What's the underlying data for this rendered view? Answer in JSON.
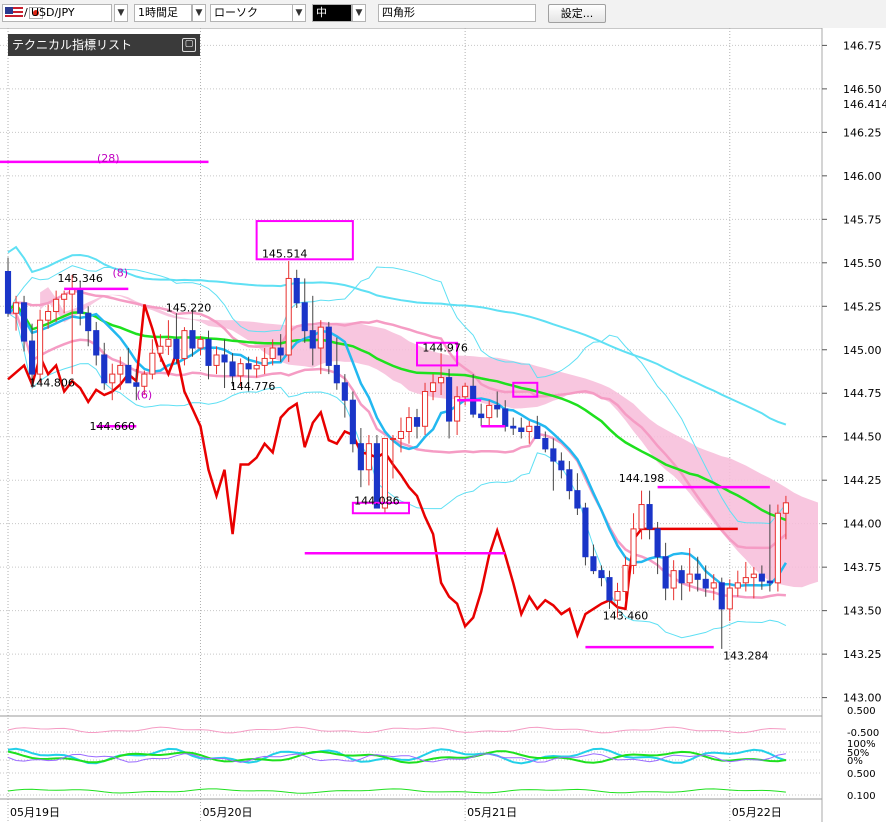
{
  "toolbar": {
    "symbol": "USD/JPY",
    "timeframe": "1時間足",
    "chart_type": "ローソク",
    "line_width": "中",
    "shape": "四角形",
    "settings_label": "設定..."
  },
  "indicator_panel": {
    "title": "テクニカル指標リスト",
    "close_glyph": "▢"
  },
  "colors": {
    "bull": "#e8312f",
    "bear": "#1a35c8",
    "ichimoku_cloud": "#f7bcd9",
    "ma_short": "#22b8f0",
    "ma_mid": "#1ee01e",
    "bollinger_outer": "#5fe0f4",
    "bollinger_mid": "#f59cc4",
    "lagging": "#e80000",
    "drawing": "#ff00ff"
  },
  "chart_data": {
    "type": "candlestick",
    "y_ticks": [
      "146.75",
      "146.50",
      "146.25",
      "146.00",
      "145.75",
      "145.50",
      "145.25",
      "145.00",
      "144.75",
      "144.50",
      "144.25",
      "144.00",
      "143.75",
      "143.50",
      "143.25",
      "143.00"
    ],
    "ylim": [
      142.9,
      146.85
    ],
    "current_price": "146.414",
    "x_labels": [
      {
        "label": "05月19日",
        "x": 0
      },
      {
        "label": "05月20日",
        "x": 24
      },
      {
        "label": "05月21日",
        "x": 57
      },
      {
        "label": "05月22日",
        "x": 90
      }
    ],
    "xlim": [
      -1,
      101.5
    ],
    "sub_ticks": [
      "0.500",
      "-0.500",
      "100%",
      "50%",
      "0%",
      "0.500",
      "0.100"
    ],
    "annotations": [
      {
        "text": "145.514",
        "x": 34.5,
        "y": 145.53
      },
      {
        "text": "145.346",
        "x": 9,
        "y": 145.39
      },
      {
        "text": "145.220",
        "x": 22.5,
        "y": 145.22
      },
      {
        "text": "144.976",
        "x": 54.5,
        "y": 144.99
      },
      {
        "text": "144.806",
        "x": 5.5,
        "y": 144.79
      },
      {
        "text": "144.776",
        "x": 30.5,
        "y": 144.77
      },
      {
        "text": "144.660",
        "x": 13,
        "y": 144.54
      },
      {
        "text": "144.086",
        "x": 46,
        "y": 144.11
      },
      {
        "text": "144.198",
        "x": 79,
        "y": 144.24
      },
      {
        "text": "143.460",
        "x": 77,
        "y": 143.45
      },
      {
        "text": "143.284",
        "x": 92,
        "y": 143.22
      },
      {
        "text": "(28)",
        "x": 12.5,
        "y": 146.08
      },
      {
        "text": "(8)",
        "x": 14,
        "y": 145.42
      },
      {
        "text": "(6)",
        "x": 17,
        "y": 144.72
      }
    ],
    "candles": [
      [
        145.45,
        145.53,
        145.19,
        145.21
      ],
      [
        145.21,
        145.31,
        145.11,
        145.27
      ],
      [
        145.27,
        145.31,
        144.99,
        145.05
      ],
      [
        145.05,
        145.15,
        144.79,
        144.86
      ],
      [
        144.86,
        145.23,
        144.81,
        145.17
      ],
      [
        145.17,
        145.26,
        145.12,
        145.22
      ],
      [
        145.22,
        145.34,
        145.16,
        145.29
      ],
      [
        145.29,
        145.34,
        145.21,
        145.32
      ],
      [
        145.32,
        145.43,
        144.86,
        145.35
      ],
      [
        145.35,
        145.39,
        145.14,
        145.21
      ],
      [
        145.21,
        145.25,
        145.02,
        145.11
      ],
      [
        145.11,
        145.16,
        144.91,
        144.97
      ],
      [
        144.97,
        145.04,
        144.77,
        144.81
      ],
      [
        144.81,
        144.92,
        144.71,
        144.86
      ],
      [
        144.86,
        144.96,
        144.77,
        144.91
      ],
      [
        144.91,
        145.01,
        144.85,
        144.81
      ],
      [
        144.81,
        144.89,
        144.71,
        144.79
      ],
      [
        144.79,
        144.88,
        144.74,
        144.86
      ],
      [
        144.86,
        145.06,
        144.83,
        144.98
      ],
      [
        144.98,
        145.09,
        144.93,
        145.02
      ],
      [
        145.02,
        145.17,
        144.97,
        145.06
      ],
      [
        145.06,
        145.21,
        144.92,
        144.95
      ],
      [
        144.95,
        145.13,
        144.91,
        145.11
      ],
      [
        145.11,
        145.23,
        144.96,
        145.01
      ],
      [
        145.01,
        145.08,
        144.97,
        145.06
      ],
      [
        145.06,
        145.11,
        144.83,
        144.91
      ],
      [
        144.91,
        145.02,
        144.86,
        144.97
      ],
      [
        144.97,
        145.06,
        144.78,
        144.93
      ],
      [
        144.93,
        144.98,
        144.79,
        144.85
      ],
      [
        144.85,
        144.95,
        144.79,
        144.92
      ],
      [
        144.92,
        144.96,
        144.76,
        144.89
      ],
      [
        144.89,
        144.96,
        144.84,
        144.91
      ],
      [
        144.91,
        145.01,
        144.86,
        144.95
      ],
      [
        144.95,
        145.06,
        144.91,
        145.01
      ],
      [
        145.01,
        145.09,
        144.93,
        144.97
      ],
      [
        144.97,
        145.51,
        144.93,
        145.41
      ],
      [
        145.41,
        145.46,
        145.24,
        145.27
      ],
      [
        145.27,
        145.41,
        145.04,
        145.11
      ],
      [
        145.11,
        145.31,
        144.91,
        145.01
      ],
      [
        145.01,
        145.17,
        144.86,
        145.13
      ],
      [
        145.13,
        145.16,
        144.86,
        144.91
      ],
      [
        144.91,
        145.07,
        144.77,
        144.81
      ],
      [
        144.81,
        144.86,
        144.61,
        144.71
      ],
      [
        144.71,
        144.76,
        144.41,
        144.46
      ],
      [
        144.46,
        144.55,
        144.21,
        144.31
      ],
      [
        144.31,
        144.51,
        144.22,
        144.46
      ],
      [
        144.46,
        144.51,
        144.11,
        144.09
      ],
      [
        144.09,
        144.36,
        144.06,
        144.49
      ],
      [
        144.49,
        144.51,
        144.26,
        144.49
      ],
      [
        144.49,
        144.61,
        144.41,
        144.53
      ],
      [
        144.53,
        144.67,
        144.46,
        144.61
      ],
      [
        144.61,
        144.66,
        144.49,
        144.56
      ],
      [
        144.56,
        144.81,
        144.51,
        144.76
      ],
      [
        144.76,
        144.86,
        144.71,
        144.81
      ],
      [
        144.81,
        144.98,
        144.74,
        144.84
      ],
      [
        144.84,
        144.89,
        144.49,
        144.59
      ],
      [
        144.59,
        144.79,
        144.51,
        144.73
      ],
      [
        144.73,
        144.81,
        144.68,
        144.79
      ],
      [
        144.79,
        144.86,
        144.61,
        144.63
      ],
      [
        144.63,
        144.69,
        144.56,
        144.61
      ],
      [
        144.61,
        144.71,
        144.56,
        144.68
      ],
      [
        144.68,
        144.76,
        144.61,
        144.66
      ],
      [
        144.66,
        144.71,
        144.53,
        144.56
      ],
      [
        144.56,
        144.61,
        144.51,
        144.55
      ],
      [
        144.55,
        144.61,
        144.49,
        144.53
      ],
      [
        144.53,
        144.59,
        144.46,
        144.56
      ],
      [
        144.56,
        144.62,
        144.51,
        144.49
      ],
      [
        144.49,
        144.53,
        144.41,
        144.43
      ],
      [
        144.43,
        144.49,
        144.19,
        144.36
      ],
      [
        144.36,
        144.41,
        144.26,
        144.31
      ],
      [
        144.31,
        144.36,
        144.14,
        144.19
      ],
      [
        144.19,
        144.29,
        144.05,
        144.09
      ],
      [
        144.09,
        144.12,
        143.76,
        143.81
      ],
      [
        143.81,
        143.88,
        143.71,
        143.73
      ],
      [
        143.73,
        143.76,
        143.64,
        143.69
      ],
      [
        143.69,
        143.73,
        143.51,
        143.56
      ],
      [
        143.56,
        143.66,
        143.46,
        143.61
      ],
      [
        143.61,
        143.81,
        143.56,
        143.76
      ],
      [
        143.76,
        144.06,
        143.71,
        143.97
      ],
      [
        143.97,
        144.19,
        143.91,
        144.11
      ],
      [
        144.11,
        144.19,
        143.91,
        143.97
      ],
      [
        143.97,
        144.01,
        143.71,
        143.81
      ],
      [
        143.81,
        143.89,
        143.56,
        143.63
      ],
      [
        143.63,
        143.79,
        143.56,
        143.73
      ],
      [
        143.73,
        143.76,
        143.56,
        143.66
      ],
      [
        143.66,
        143.86,
        143.61,
        143.71
      ],
      [
        143.71,
        143.81,
        143.61,
        143.68
      ],
      [
        143.68,
        143.76,
        143.58,
        143.63
      ],
      [
        143.63,
        143.71,
        143.56,
        143.66
      ],
      [
        143.66,
        143.69,
        143.28,
        143.51
      ],
      [
        143.51,
        143.68,
        143.44,
        143.63
      ],
      [
        143.63,
        143.73,
        143.58,
        143.66
      ],
      [
        143.66,
        143.78,
        143.61,
        143.69
      ],
      [
        143.69,
        143.75,
        143.57,
        143.71
      ],
      [
        143.71,
        143.76,
        143.62,
        143.67
      ],
      [
        143.67,
        144.11,
        143.61,
        143.66
      ],
      [
        143.66,
        144.11,
        143.61,
        144.06
      ],
      [
        144.06,
        144.16,
        143.91,
        144.12
      ]
    ]
  }
}
